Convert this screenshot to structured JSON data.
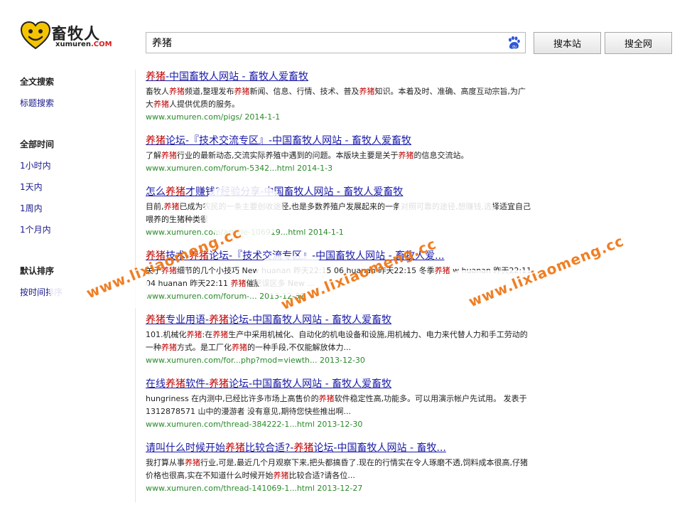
{
  "logo": {
    "cn": "畜牧人",
    "en_main": "xumuren",
    "en_dot": ".COM"
  },
  "search": {
    "query": "养猪",
    "placeholder": ""
  },
  "buttons": {
    "site": "搜本站",
    "web": "搜全网"
  },
  "sidebar": {
    "groups": [
      {
        "title": "全文搜索",
        "items": [
          "标题搜索"
        ]
      },
      {
        "title": "全部时间",
        "items": [
          "1小时内",
          "1天内",
          "1周内",
          "1个月内"
        ]
      },
      {
        "title": "默认排序",
        "items": [
          "按时间排序"
        ]
      }
    ]
  },
  "results": [
    {
      "title": [
        {
          "t": "养猪",
          "h": true
        },
        {
          "t": "-中国畜牧人网站 - 畜牧人爱畜牧",
          "h": false
        }
      ],
      "desc": [
        {
          "t": "畜牧人",
          "h": false
        },
        {
          "t": "养猪",
          "h": true
        },
        {
          "t": "频道,整理发布",
          "h": false
        },
        {
          "t": "养猪",
          "h": true
        },
        {
          "t": "新闻、信息、行情、技术、普及",
          "h": false
        },
        {
          "t": "养猪",
          "h": true
        },
        {
          "t": "知识。本着及时、准确、高度互动宗旨,为广大",
          "h": false
        },
        {
          "t": "养猪",
          "h": true
        },
        {
          "t": "人提供优质的服务。",
          "h": false
        }
      ],
      "url": "www.xumuren.com/pigs/ 2014-1-1"
    },
    {
      "title": [
        {
          "t": "养猪",
          "h": true
        },
        {
          "t": "论坛-『技术交流专区』-中国畜牧人网站 - 畜牧人爱畜牧",
          "h": false
        }
      ],
      "desc": [
        {
          "t": "了解",
          "h": false
        },
        {
          "t": "养猪",
          "h": true
        },
        {
          "t": "行业的最新动态,交流实际养殖中遇到的问题。本版块主要是关于",
          "h": false
        },
        {
          "t": "养猪",
          "h": true
        },
        {
          "t": "的信息交流站。",
          "h": false
        }
      ],
      "url": "www.xumuren.com/forum-5342...html 2014-1-3"
    },
    {
      "title": [
        {
          "t": "怎么",
          "h": false
        },
        {
          "t": "养猪",
          "h": true
        },
        {
          "t": "才赚钱?经验分享-中国畜牧人网站 - 畜牧人爱畜牧",
          "h": false
        }
      ],
      "desc": [
        {
          "t": "目前,",
          "h": false
        },
        {
          "t": "养猪",
          "h": true
        },
        {
          "t": "已成为农民的一条主要创收途径,也是多数养殖户发展起来的一条对照可靠的途径,想赚钱,选择适宜自己喂养的生猪种类很",
          "h": false
        }
      ],
      "url": "www.xumuren.com/article-106919...html 2014-1-1"
    },
    {
      "title": [
        {
          "t": "养猪",
          "h": true
        },
        {
          "t": "技术-",
          "h": false
        },
        {
          "t": "养猪",
          "h": true
        },
        {
          "t": "论坛-『技术交流专区』-中国畜牧人网站 - 畜牧人爱...",
          "h": false
        }
      ],
      "desc": [
        {
          "t": "关于",
          "h": false
        },
        {
          "t": "养猪",
          "h": true
        },
        {
          "t": "细节的几个小技巧 New huanan 昨天22:15 06 huanan 昨天22:15 冬季",
          "h": false
        },
        {
          "t": "养猪",
          "h": true
        },
        {
          "t": " w huanan 昨天22:11 04 huanan 昨天22:11 ",
          "h": false
        },
        {
          "t": "养猪",
          "h": true
        },
        {
          "t": "催肥误区多 New ...",
          "h": false
        }
      ],
      "url": "www.xumuren.com/forum-... 2013-12-31"
    },
    {
      "title": [
        {
          "t": "养猪",
          "h": true
        },
        {
          "t": "专业用语-",
          "h": false
        },
        {
          "t": "养猪",
          "h": true
        },
        {
          "t": "论坛-中国畜牧人网站 - 畜牧人爱畜牧",
          "h": false
        }
      ],
      "desc": [
        {
          "t": "101.机械化",
          "h": false
        },
        {
          "t": "养猪",
          "h": true
        },
        {
          "t": ":在",
          "h": false
        },
        {
          "t": "养猪",
          "h": true
        },
        {
          "t": "生产中采用机械化、自动化的机电设备和设施,用机械力、电力来代替人力和手工劳动的一种",
          "h": false
        },
        {
          "t": "养猪",
          "h": true
        },
        {
          "t": "方式。是工厂化",
          "h": false
        },
        {
          "t": "养猪",
          "h": true
        },
        {
          "t": "的一种手段,不仅能解放体力...",
          "h": false
        }
      ],
      "url": "www.xumuren.com/for...php?mod=viewth... 2013-12-30"
    },
    {
      "title": [
        {
          "t": "在线",
          "h": false
        },
        {
          "t": "养猪",
          "h": true
        },
        {
          "t": "软件-",
          "h": false
        },
        {
          "t": "养猪",
          "h": true
        },
        {
          "t": "论坛-中国畜牧人网站 - 畜牧人爱畜牧",
          "h": false
        }
      ],
      "desc": [
        {
          "t": "hungriness 在内测中,已经比许多市场上高售价的",
          "h": false
        },
        {
          "t": "养猪",
          "h": true
        },
        {
          "t": "软件稳定性高,功能多。可以用演示帐户先试用。 发表于 1312878571 山中的漫游者 没有意见,期待您快些推出啊...",
          "h": false
        }
      ],
      "url": "www.xumuren.com/thread-384222-1...html 2013-12-30"
    },
    {
      "title": [
        {
          "t": "请叫什么时候开始",
          "h": false
        },
        {
          "t": "养猪",
          "h": true
        },
        {
          "t": "比较合适?-",
          "h": false
        },
        {
          "t": "养猪",
          "h": true
        },
        {
          "t": "论坛-中国畜牧人网站 - 畜牧...",
          "h": false
        }
      ],
      "desc": [
        {
          "t": "我打算从事",
          "h": false
        },
        {
          "t": "养猪",
          "h": true
        },
        {
          "t": "行业,可是,最近几个月观察下来,把头都搞昏了.现在的行情实在令人琢磨不透,饲料成本很高,仔猪价格也很高,实在不知道什么时候开始",
          "h": false
        },
        {
          "t": "养猪",
          "h": true
        },
        {
          "t": "比较合适?请各位...",
          "h": false
        }
      ],
      "url": "www.xumuren.com/thread-141069-1...html 2013-12-27"
    }
  ],
  "watermarks": [
    "www.lixiaomeng.cc",
    "www.lixiaomeng.cc",
    "www.lixiaomeng.cc"
  ],
  "colors": {
    "link": "#1a1aa8",
    "highlight": "#c00000",
    "url": "#2a8a2a",
    "watermark": "#f07818",
    "logo_yellow": "#f5c400"
  }
}
